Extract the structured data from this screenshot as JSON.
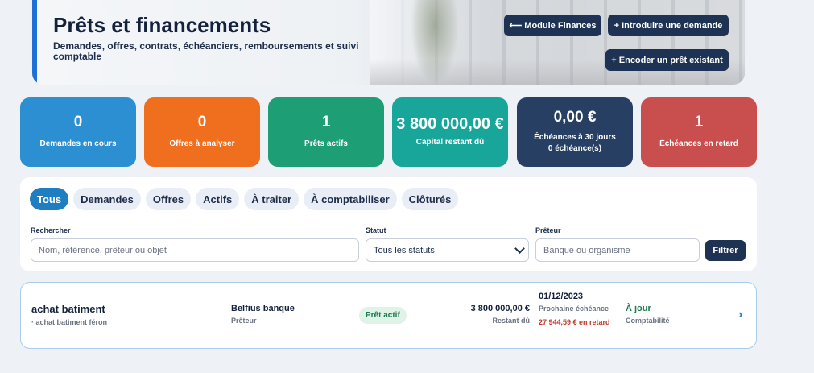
{
  "header": {
    "title": "Prêts et financements",
    "subtitle": "Demandes, offres, contrats, échéanciers, remboursements et suivi comptable",
    "buttons": {
      "module_finances": "⟵ Module Finances",
      "introduce_request": "+ Introduire une demande",
      "encode_loan": "+ Encoder un prêt existant"
    }
  },
  "stats": [
    {
      "value": "0",
      "label": "Demandes en cours",
      "color": "#2b8fd1"
    },
    {
      "value": "0",
      "label": "Offres à analyser",
      "color": "#ef6f1f"
    },
    {
      "value": "1",
      "label": "Prêts actifs",
      "color": "#1d9e74"
    },
    {
      "value": "3 800 000,00 €",
      "label": "Capital restant dû",
      "color": "#18a59a"
    },
    {
      "value": "0,00 €",
      "label": "Échéances à 30 jours",
      "label2": "0 échéance(s)",
      "color": "#263f63"
    },
    {
      "value": "1",
      "label": "Échéances en retard",
      "color": "#c94f4f"
    }
  ],
  "tabs": [
    "Tous",
    "Demandes",
    "Offres",
    "Actifs",
    "À traiter",
    "À comptabiliser",
    "Clôturés"
  ],
  "active_tab": "Tous",
  "filters": {
    "search_label": "Rechercher",
    "search_placeholder": "Nom, référence, prêteur ou objet",
    "status_label": "Statut",
    "status_value": "Tous les statuts",
    "lender_label": "Prêteur",
    "lender_placeholder": "Banque ou organisme",
    "filter_button": "Filtrer"
  },
  "loans": [
    {
      "object": "achat batiment",
      "object_sub": "· achat batiment féron",
      "lender": "Belfius banque",
      "lender_sub": "Prêteur",
      "badge": "Prêt actif",
      "amount": "3 800 000,00 €",
      "amount_sub": "Restant dû",
      "next_date": "01/12/2023",
      "next_label": "Prochaine échéance",
      "late_text": "27 944,59 € en retard",
      "status": "À jour",
      "status_sub": "Comptabilité",
      "arrow": "›"
    }
  ]
}
